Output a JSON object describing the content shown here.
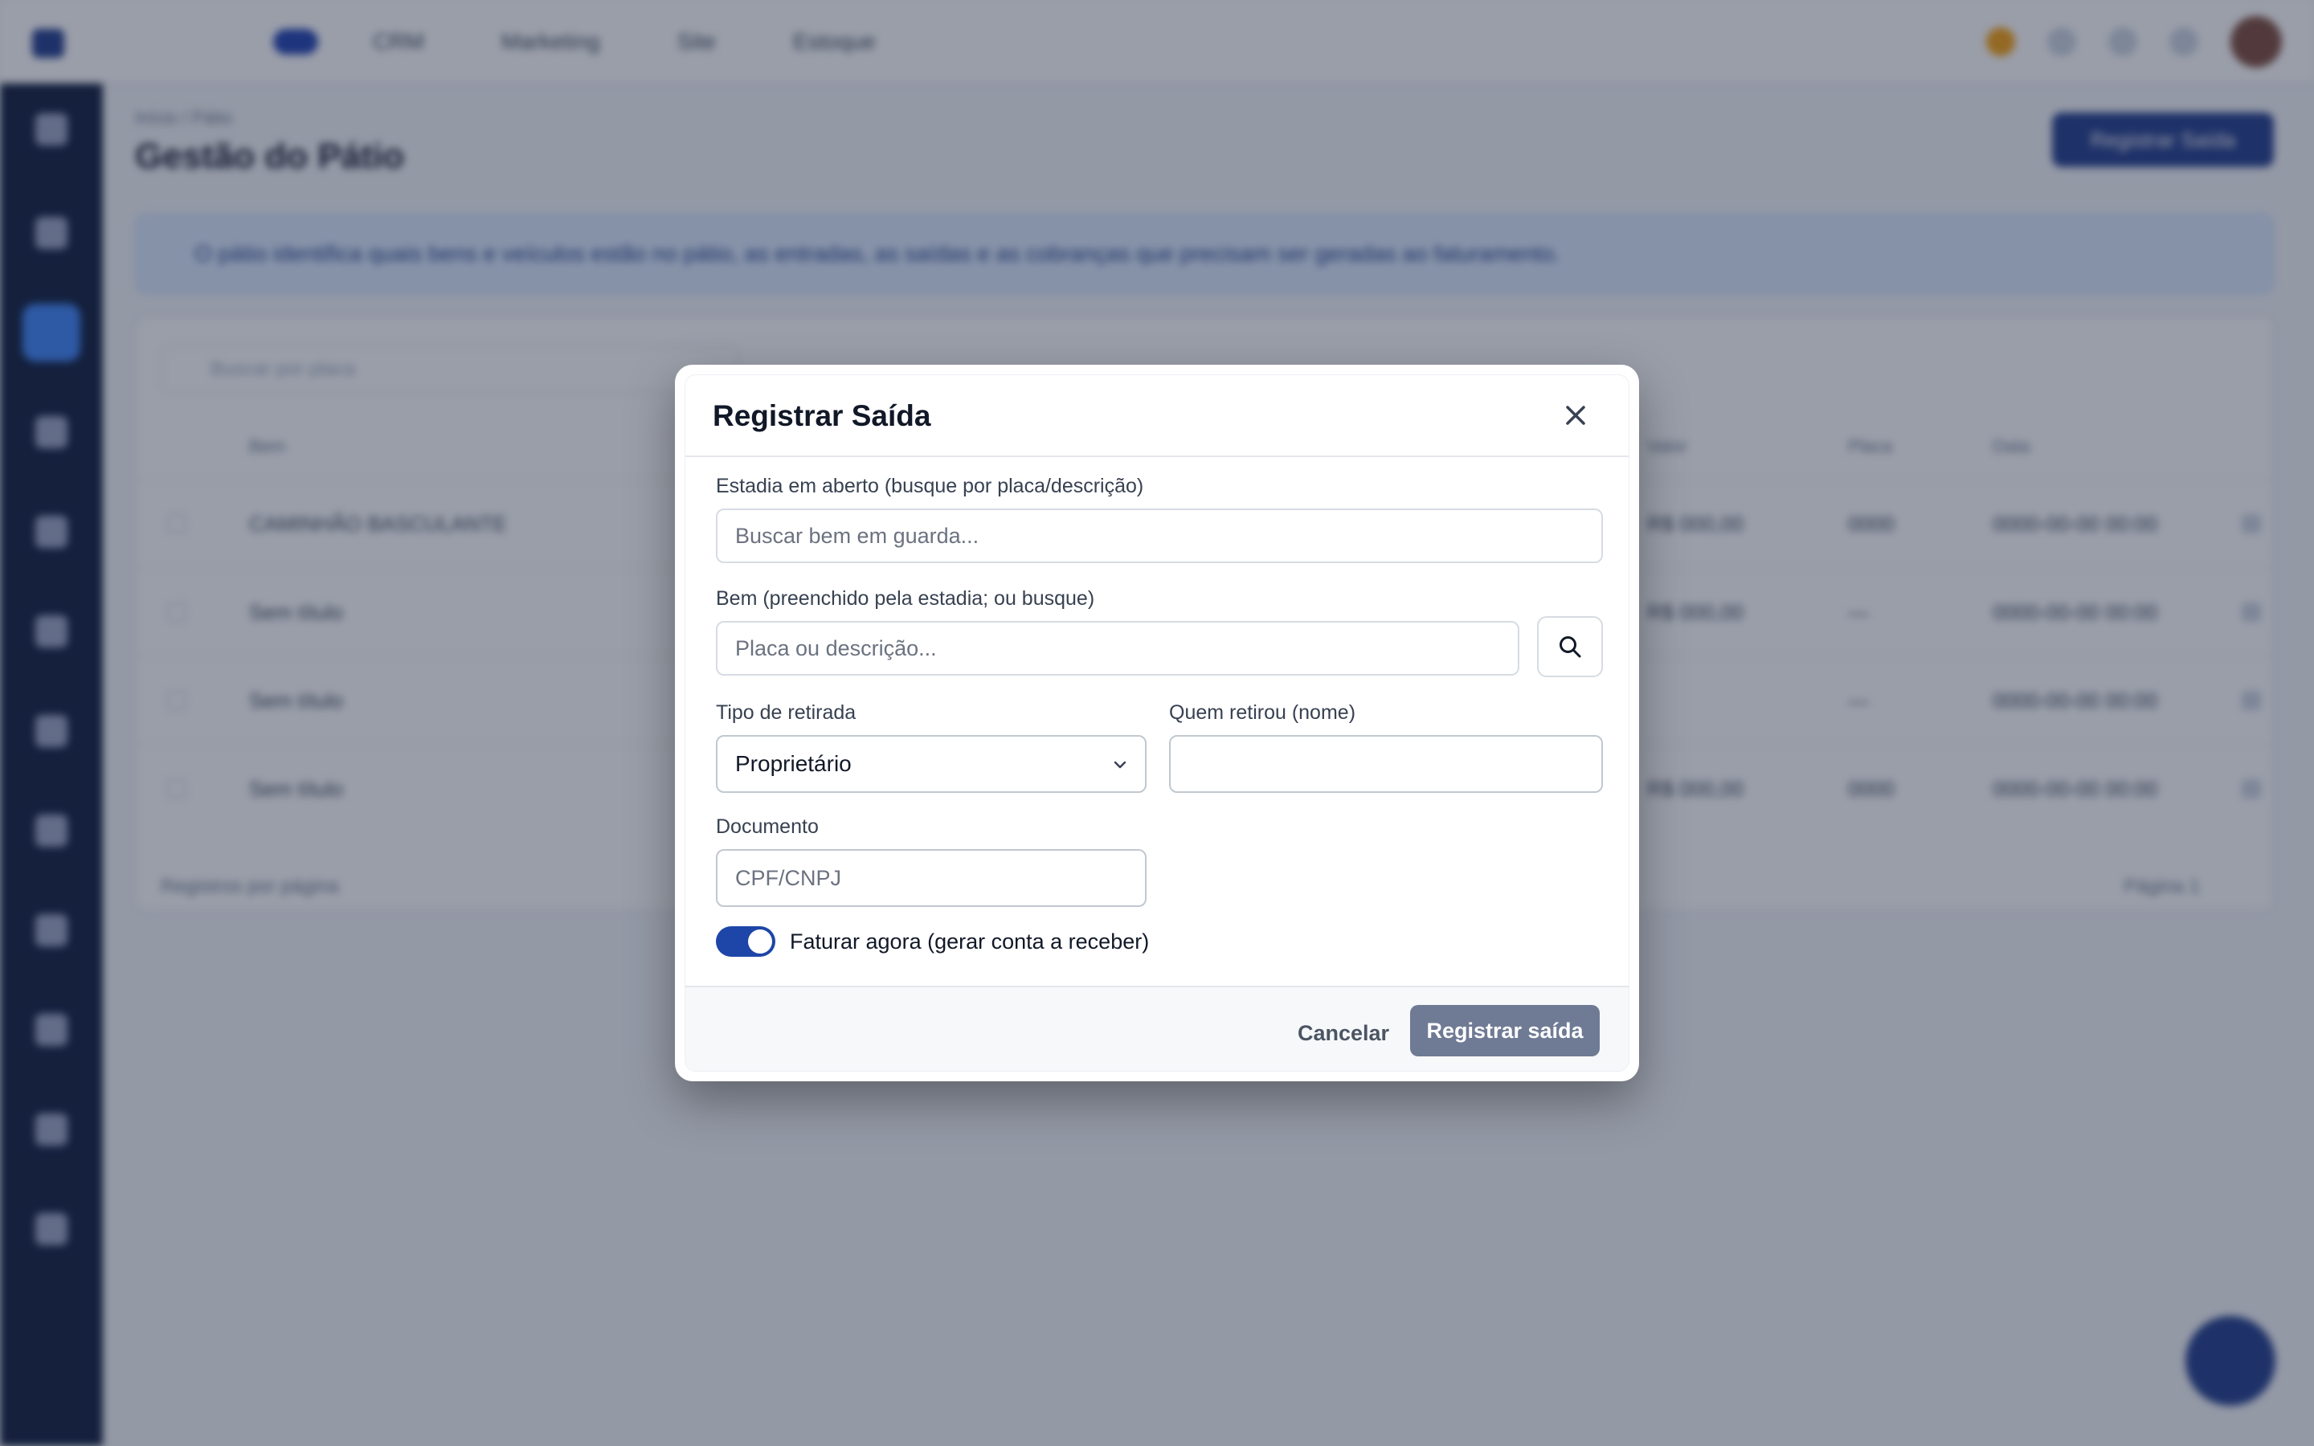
{
  "background": {
    "top_nav": [
      "",
      "CRM",
      "Marketing",
      "Site",
      "Estoque"
    ],
    "breadcrumb": "Início  /  Pátio",
    "page_title": "Gestão do Pátio",
    "new_button": "Registrar Saída",
    "info_banner": "O pátio identifica quais bens e veículos estão no pátio, as entradas, as saídas e as cobranças que precisam ser geradas ao faturamento.",
    "search_placeholder": "Buscar por placa",
    "table_headers": [
      "Bem",
      "Valor",
      "Placa",
      "Data"
    ],
    "rows": [
      {
        "name": "CAMINHÃO BASCULANTE",
        "value": "R$ 000,00",
        "plate": "0000",
        "date": "0000-00-00 00:00"
      },
      {
        "name": "Sem título",
        "value": "R$ 000,00",
        "plate": "—",
        "date": "0000-00-00 00:00"
      },
      {
        "name": "Sem título",
        "value": "",
        "plate": "—",
        "date": "0000-00-00 00:00"
      },
      {
        "name": "Sem título",
        "value": "R$ 000,00",
        "plate": "0000",
        "date": "0000-00-00 00:00"
      }
    ],
    "footer_left": "Registros por página",
    "footer_right": "Página 1"
  },
  "modal": {
    "title": "Registrar Saída",
    "stay_field": {
      "label": "Estadia em aberto (busque por placa/descrição)",
      "placeholder": "Buscar bem em guarda...",
      "value": ""
    },
    "asset_field": {
      "label": "Bem (preenchido pela estadia; ou busque)",
      "placeholder": "Placa ou descrição...",
      "value": ""
    },
    "withdrawal_type": {
      "label": "Tipo de retirada",
      "selected": "Proprietário"
    },
    "withdrawn_by": {
      "label": "Quem retirou (nome)",
      "value": ""
    },
    "document": {
      "label": "Documento",
      "placeholder": "CPF/CNPJ",
      "value": ""
    },
    "invoice_toggle": {
      "label": "Faturar agora (gerar conta a receber)",
      "on": true
    },
    "cancel_label": "Cancelar",
    "submit_label": "Registrar saída"
  },
  "colors": {
    "accent": "#1e46a8",
    "submit_disabled": "#6f7a94",
    "sidebar": "#0b1a3a",
    "overlay": "rgba(31,41,64,0.45)"
  },
  "icons": {
    "close": "close-icon",
    "search": "search-icon",
    "select": "chevron-down-icon"
  }
}
